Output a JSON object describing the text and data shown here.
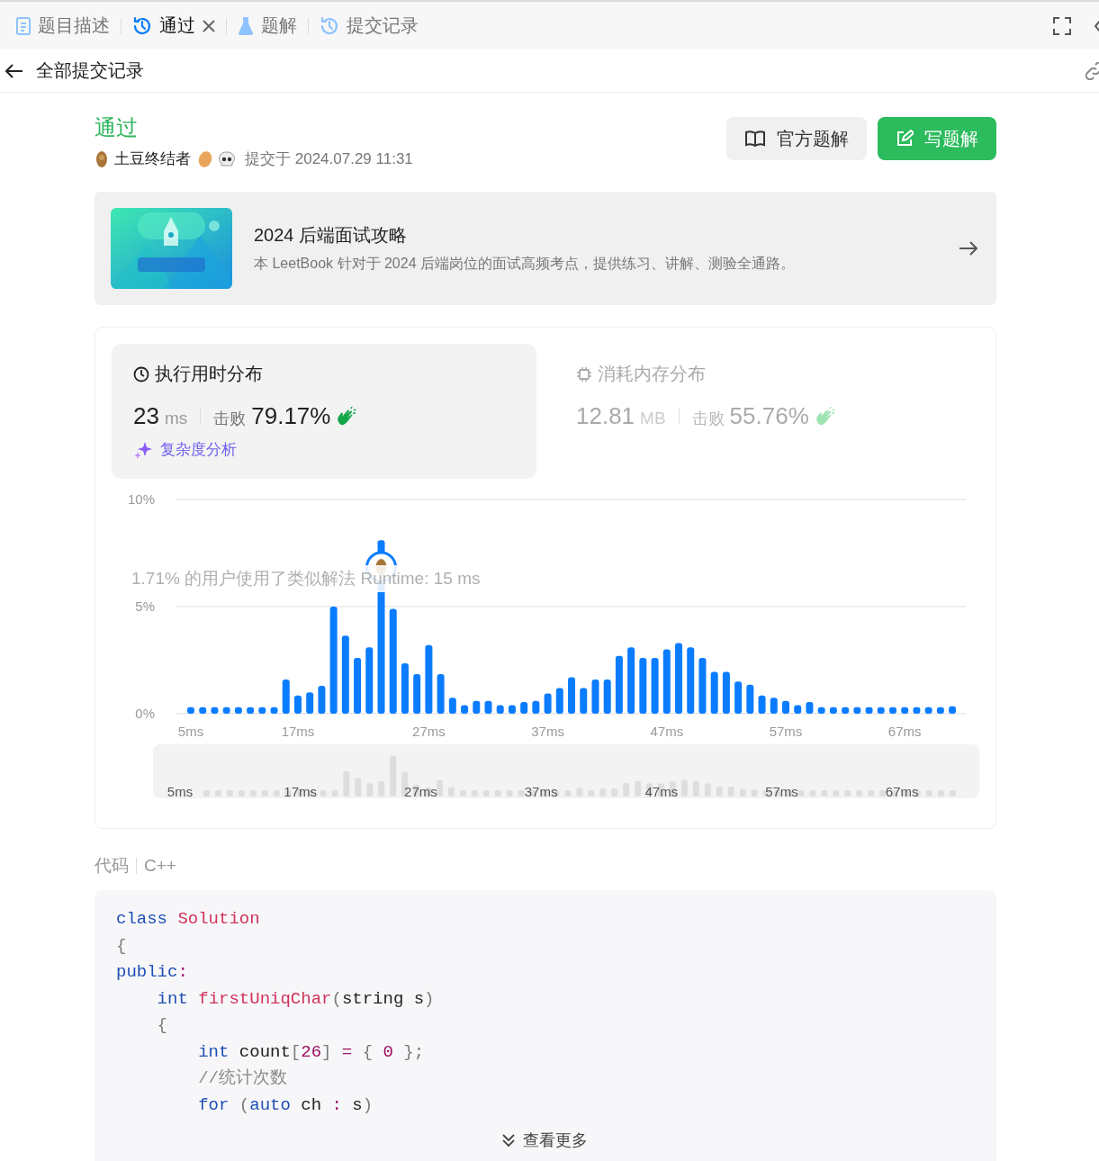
{
  "tabs": [
    {
      "label": "题目描述",
      "selected": false,
      "closable": false
    },
    {
      "label": "通过",
      "selected": true,
      "closable": true
    },
    {
      "label": "题解",
      "selected": false,
      "closable": false
    },
    {
      "label": "提交记录",
      "selected": false,
      "closable": false
    }
  ],
  "back_title": "全部提交记录",
  "result": {
    "status": "通过",
    "user": "土豆终结者",
    "submitted": "提交于 2024.07.29 11:31"
  },
  "buttons": [
    {
      "label": "官方题解",
      "kind": "secondary"
    },
    {
      "label": "写题解",
      "kind": "primary"
    }
  ],
  "banner": {
    "kind": "picture",
    "title": "2024 后端面试攻略",
    "description": "本 LeetBook 针对于 2024 后端岗位的面试高频考点，提供练习、讲解、测验全通路。"
  },
  "stats": [
    {
      "title": "执行用时分布",
      "value": "23",
      "unit": "ms",
      "beat_label": "击败",
      "beat": "79.17%",
      "selected": true,
      "link": "复杂度分析"
    },
    {
      "title": "消耗内存分布",
      "value": "12.81",
      "unit": "MB",
      "beat_label": "击败",
      "beat": "55.76%",
      "selected": false
    }
  ],
  "chart_data": {
    "type": "bar",
    "categories": [
      "5ms",
      null,
      null,
      null,
      null,
      null,
      null,
      null,
      null,
      "17ms",
      null,
      null,
      null,
      null,
      null,
      null,
      null,
      null,
      null,
      null,
      "27ms",
      null,
      null,
      null,
      null,
      null,
      null,
      null,
      null,
      null,
      "37ms",
      null,
      null,
      null,
      null,
      null,
      null,
      null,
      null,
      null,
      "47ms",
      null,
      null,
      null,
      null,
      null,
      null,
      null,
      null,
      null,
      "57ms",
      null,
      null,
      null,
      null,
      null,
      null,
      null,
      null,
      null,
      "67ms",
      null,
      null,
      null,
      null
    ],
    "series": [
      {
        "color": "#0a7cff",
        "values": [
          0.3,
          0.3,
          0.3,
          0.3,
          0.3,
          0.3,
          0.3,
          0.3,
          1.6,
          0.85,
          1.0,
          1.3,
          5.0,
          3.65,
          2.6,
          3.1,
          8.1,
          4.9,
          2.35,
          1.85,
          3.2,
          1.85,
          0.75,
          0.4,
          0.6,
          0.6,
          0.4,
          0.4,
          0.55,
          0.6,
          0.95,
          1.2,
          1.7,
          1.2,
          1.6,
          1.6,
          2.7,
          3.1,
          2.6,
          2.6,
          3.0,
          3.3,
          3.1,
          2.6,
          1.95,
          1.95,
          1.5,
          1.35,
          0.85,
          0.75,
          0.6,
          0.4,
          0.55,
          0.3,
          0.3,
          0.3,
          0.3,
          0.3,
          0.3,
          0.3,
          0.3,
          0.3,
          0.3,
          0.3,
          0.35
        ]
      }
    ],
    "ylim": [
      0,
      10
    ],
    "yticks": [
      {
        "value": 0,
        "label": "0%"
      },
      {
        "value": 5,
        "label": "5%"
      },
      {
        "value": 10,
        "label": "10%"
      }
    ]
  },
  "tooltip": "1.71% 的用户使用了类似解法 Runtime: 15 ms",
  "navigator_labels": [
    "5ms",
    "17ms",
    "27ms",
    "37ms",
    "47ms",
    "57ms",
    "67ms"
  ],
  "code": {
    "label": "代码",
    "language": "C++",
    "more": "查看更多",
    "lines": [
      [
        {
          "kind": "keyword",
          "text": "class"
        },
        {
          "kind": "name",
          "text": " Solution"
        }
      ],
      [
        {
          "kind": "punct",
          "text": "{"
        }
      ],
      [
        {
          "kind": "keyword",
          "text": "public"
        },
        {
          "kind": "operator",
          "text": ":"
        }
      ],
      [
        {
          "kind": "keyword",
          "text": "    int"
        },
        {
          "kind": "name",
          "text": " firstUniqChar"
        },
        {
          "kind": "punct",
          "text": "("
        },
        {
          "kind": "plain",
          "text": "string s"
        },
        {
          "kind": "punct",
          "text": ")"
        }
      ],
      [
        {
          "kind": "punct",
          "text": "    {"
        }
      ],
      [
        {
          "kind": "keyword",
          "text": "        int"
        },
        {
          "kind": "plain",
          "text": " count"
        },
        {
          "kind": "punct",
          "text": "["
        },
        {
          "kind": "number",
          "text": "26"
        },
        {
          "kind": "punct",
          "text": "]"
        },
        {
          "kind": "operator",
          "text": " ="
        },
        {
          "kind": "punct",
          "text": " { "
        },
        {
          "kind": "number",
          "text": "0"
        },
        {
          "kind": "punct",
          "text": " };"
        }
      ],
      [
        {
          "kind": "comment",
          "text": "        //统计次数"
        }
      ],
      [
        {
          "kind": "keyword",
          "text": "        for"
        },
        {
          "kind": "punct",
          "text": " ("
        },
        {
          "kind": "keyword",
          "text": "auto"
        },
        {
          "kind": "plain",
          "text": " ch "
        },
        {
          "kind": "operator",
          "text": ":"
        },
        {
          "kind": "plain",
          "text": " s"
        },
        {
          "kind": "punct",
          "text": ")"
        }
      ]
    ]
  }
}
